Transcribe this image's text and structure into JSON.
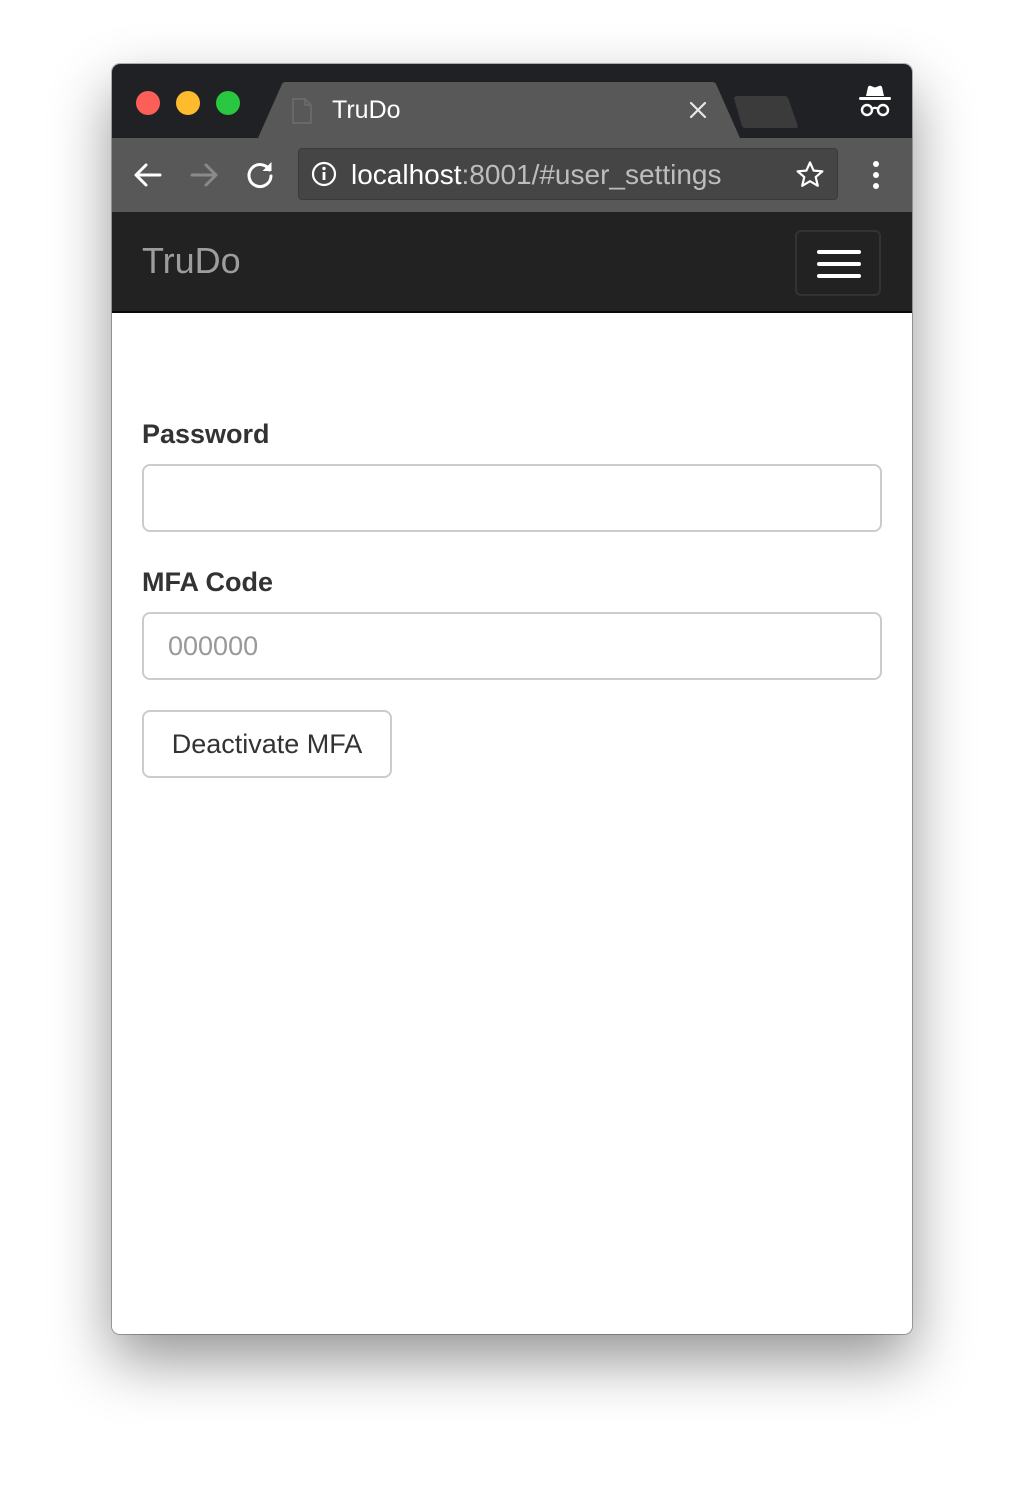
{
  "browser": {
    "tab_title": "TruDo",
    "address_host": "localhost",
    "address_rest": ":8001/#user_settings"
  },
  "navbar": {
    "brand": "TruDo"
  },
  "form": {
    "password_label": "Password",
    "password_value": "",
    "mfa_label": "MFA Code",
    "mfa_placeholder": "000000",
    "mfa_value": "",
    "deactivate_button": "Deactivate MFA"
  },
  "colors": {
    "navbar_bg": "#222222",
    "brand_text": "#9d9d9d",
    "tabstrip_bg": "#202124",
    "toolbar_bg": "#585858"
  },
  "icons": {
    "traffic_lights": [
      "close-dot",
      "minimize-dot",
      "zoom-dot"
    ],
    "tab": [
      "page-favicon-icon",
      "close-tab-icon"
    ],
    "toolbar": [
      "back-arrow-icon",
      "forward-arrow-icon",
      "reload-icon",
      "info-icon",
      "star-icon",
      "more-menu-icon"
    ],
    "incognito": "incognito-icon",
    "navbar": "hamburger-menu-icon"
  }
}
